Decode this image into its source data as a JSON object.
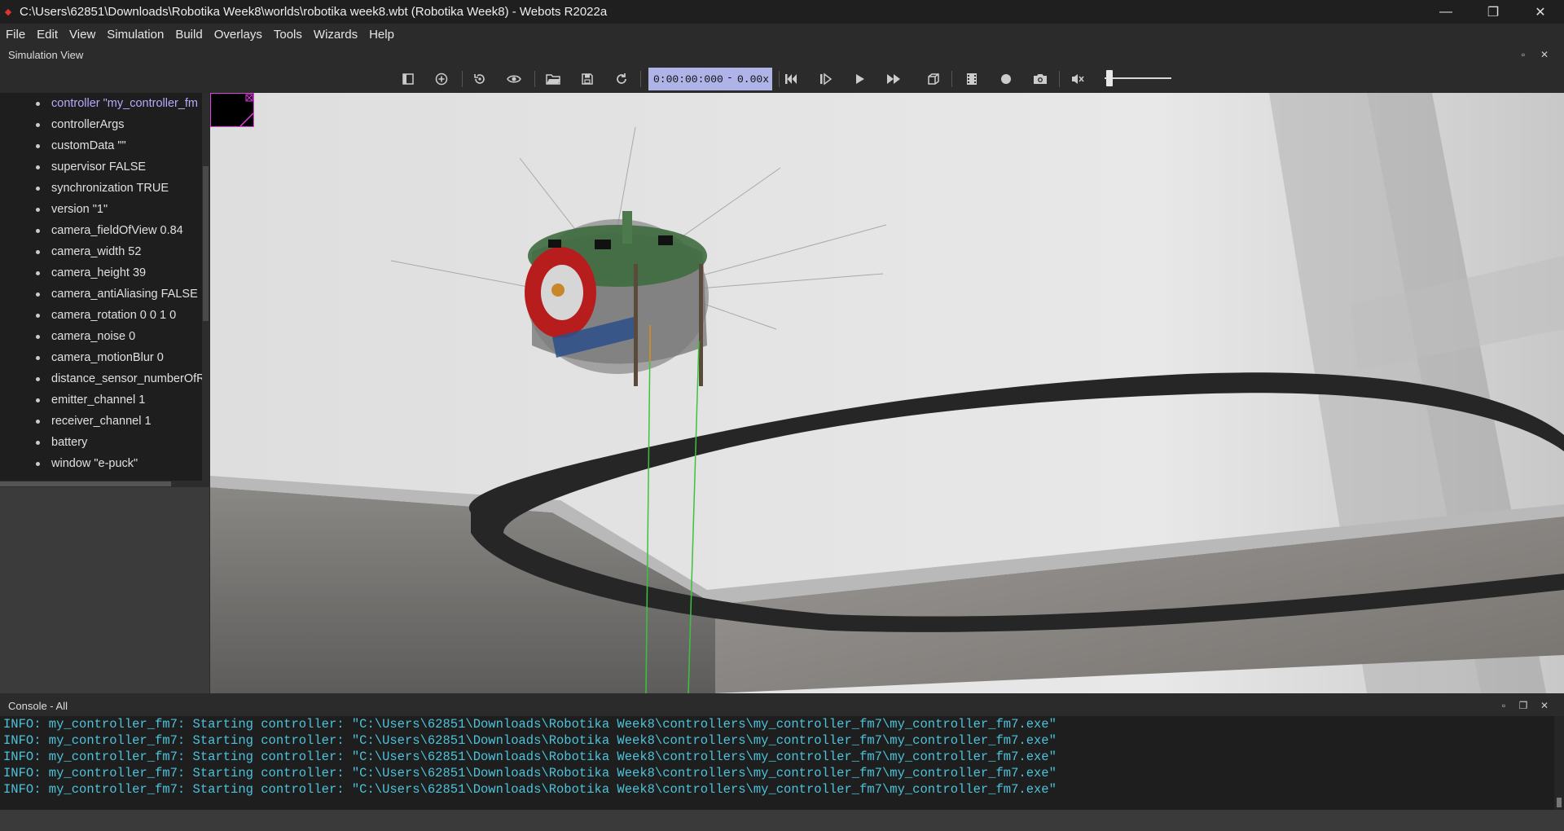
{
  "window": {
    "title": "C:\\Users\\62851\\Downloads\\Robotika Week8\\worlds\\robotika week8.wbt (Robotika Week8) - Webots R2022a",
    "minimize": "—",
    "maximize": "❐",
    "close": "✕"
  },
  "menu": [
    "File",
    "Edit",
    "View",
    "Simulation",
    "Build",
    "Overlays",
    "Tools",
    "Wizards",
    "Help"
  ],
  "simulation_view": {
    "label": "Simulation View",
    "undock": "▫",
    "close": "✕"
  },
  "toolbar": {
    "time": "0:00:00:000",
    "time_dash": "-",
    "speed": "0.00x",
    "icons": [
      "toggle-scene-tree-icon",
      "add-node-icon",
      "reset-viewpoint-icon",
      "eye-icon",
      "open-world-icon",
      "save-world-icon",
      "reload-world-icon",
      "reset-icon",
      "step-icon",
      "play-icon",
      "fast-forward-icon",
      "rendering-icon",
      "record-movie-icon",
      "record-icon",
      "screenshot-icon",
      "mute-icon"
    ],
    "volume_level": 0.05
  },
  "scene_tree": {
    "items": [
      "controller \"my_controller_fm",
      "controllerArgs",
      "customData \"\"",
      "supervisor FALSE",
      "synchronization TRUE",
      "version \"1\"",
      "camera_fieldOfView 0.84",
      "camera_width 52",
      "camera_height 39",
      "camera_antiAliasing FALSE",
      "camera_rotation 0 0 1 0",
      "camera_noise 0",
      "camera_motionBlur 0",
      "distance_sensor_numberOfR",
      "emitter_channel 1",
      "receiver_channel 1",
      "battery",
      "window \"e-puck\""
    ]
  },
  "console": {
    "label": "Console - All",
    "lines": [
      "INFO: my_controller_fm7: Starting controller: \"C:\\Users\\62851\\Downloads\\Robotika Week8\\controllers\\my_controller_fm7\\my_controller_fm7.exe\"",
      "INFO: my_controller_fm7: Starting controller: \"C:\\Users\\62851\\Downloads\\Robotika Week8\\controllers\\my_controller_fm7\\my_controller_fm7.exe\"",
      "INFO: my_controller_fm7: Starting controller: \"C:\\Users\\62851\\Downloads\\Robotika Week8\\controllers\\my_controller_fm7\\my_controller_fm7.exe\"",
      "INFO: my_controller_fm7: Starting controller: \"C:\\Users\\62851\\Downloads\\Robotika Week8\\controllers\\my_controller_fm7\\my_controller_fm7.exe\"",
      "INFO: my_controller_fm7: Starting controller: \"C:\\Users\\62851\\Downloads\\Robotika Week8\\controllers\\my_controller_fm7\\my_controller_fm7.exe\""
    ]
  }
}
